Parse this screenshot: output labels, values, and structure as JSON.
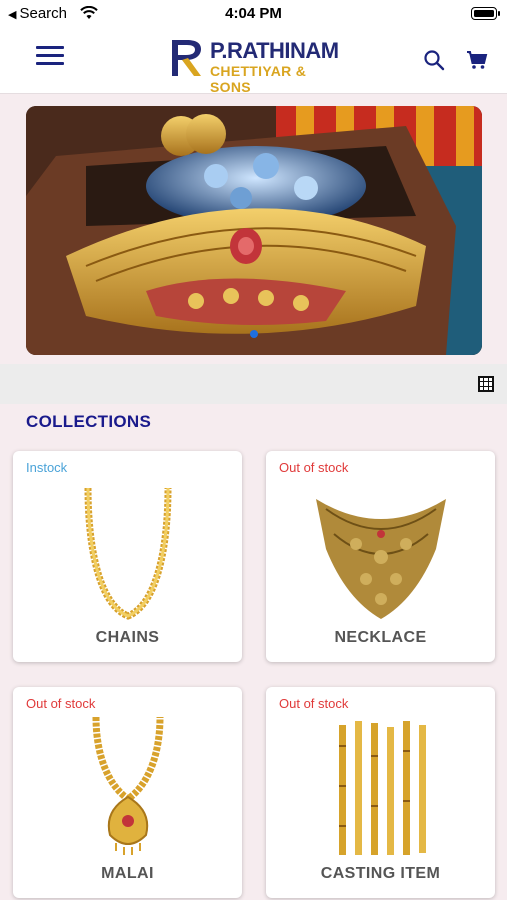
{
  "status_bar": {
    "back_label": "Search",
    "time": "4:04 PM"
  },
  "header": {
    "brand_line1": "P.RATHINAM",
    "brand_line2": "CHETTIYAR & SONS",
    "brand_colors": {
      "primary": "#232a75",
      "gold": "#d9a520"
    }
  },
  "banner": {
    "slide_count": 1,
    "active_slide": 1
  },
  "collections": {
    "title": "COLLECTIONS",
    "items": [
      {
        "name": "CHAINS",
        "stock": "Instock",
        "icon": "gold-chain-image"
      },
      {
        "name": "NECKLACE",
        "stock": "Out of stock",
        "icon": "necklace-image"
      },
      {
        "name": "MALAI",
        "stock": "Out of stock",
        "icon": "malai-pendant-image"
      },
      {
        "name": "CASTING ITEM",
        "stock": "Out of stock",
        "icon": "casting-bangles-image"
      }
    ]
  }
}
